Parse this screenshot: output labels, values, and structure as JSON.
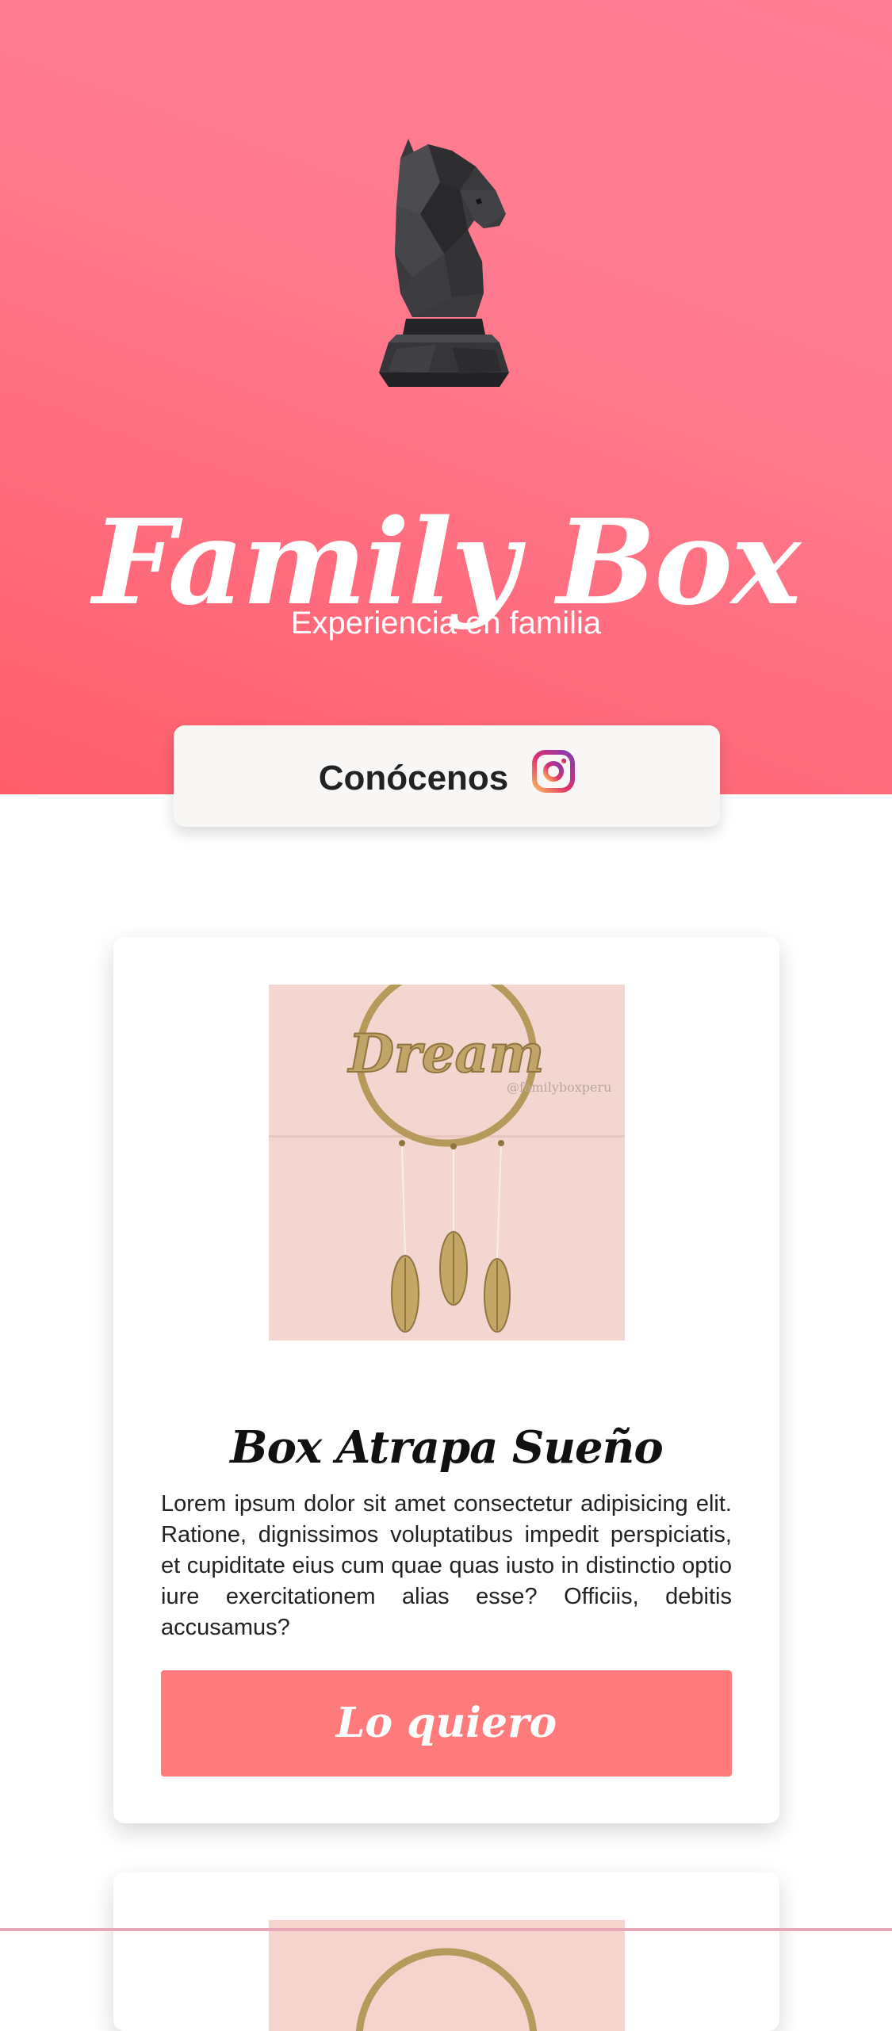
{
  "hero": {
    "title": "Family Box",
    "subtitle": "Experiencia en familia",
    "logo_icon": "chess-knight-icon",
    "gradient_colors": [
      "#ff7e95",
      "#ff5d6a"
    ]
  },
  "about": {
    "label": "Conócenos",
    "icon": "instagram-icon"
  },
  "products": [
    {
      "image_text": "Dream",
      "image_watermark": "@familyboxperu",
      "title": "Box Atrapa Sueño",
      "description": "Lorem ipsum dolor sit amet consectetur adipisicing elit. Ratione, dignissimos voluptatibus impedit perspiciatis, et cupiditate eius cum quae quas iusto in distinctio optio iure exercitationem alias esse? Officiis, debitis accusamus?",
      "button_label": "Lo quiero",
      "button_color": "#ff7b7b"
    }
  ]
}
